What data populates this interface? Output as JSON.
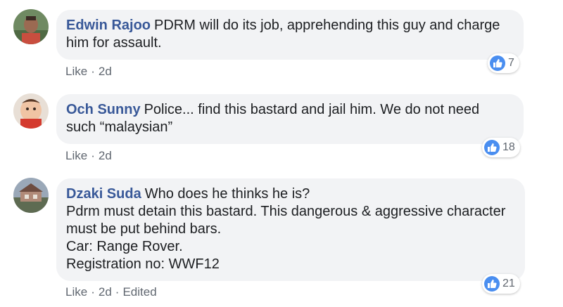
{
  "accent_color": "#385898",
  "reaction_color": "#4a8ef0",
  "comments": [
    {
      "author": "Edwin Rajoo",
      "text_lines": [
        "PDRM will do its job, apprehending this guy and charge",
        "him for assault."
      ],
      "like_label": "Like",
      "time": "2d",
      "reaction_count": "7",
      "reaction_icon": "thumbs-up-icon"
    },
    {
      "author": "Och Sunny",
      "text_lines": [
        "Police... find this bastard and jail him. We do not need",
        "such “malaysian”"
      ],
      "like_label": "Like",
      "time": "2d",
      "reaction_count": "18",
      "reaction_icon": "thumbs-up-icon"
    },
    {
      "author": "Dzaki Suda",
      "text_lines": [
        "Who does he thinks he is?",
        "Pdrm must detain this bastard. This dangerous & aggressive character",
        "must be put behind bars.",
        "Car: Range Rover.",
        "Registration no: WWF12"
      ],
      "like_label": "Like",
      "time": "2d",
      "edited_label": "Edited",
      "reaction_count": "21",
      "reaction_icon": "thumbs-up-icon"
    }
  ]
}
